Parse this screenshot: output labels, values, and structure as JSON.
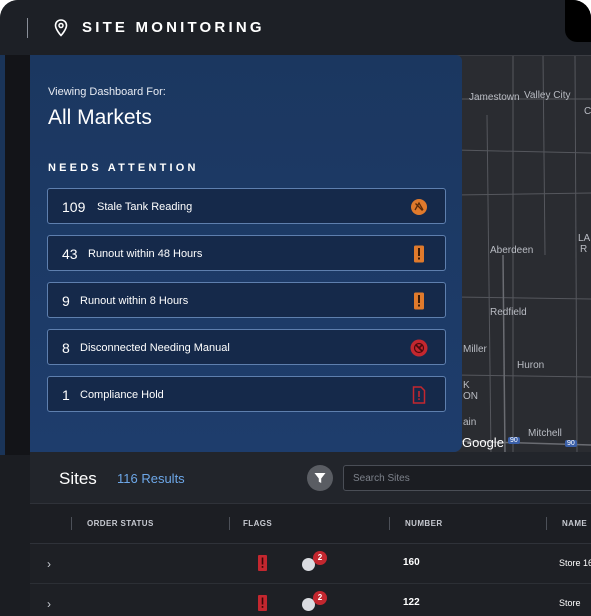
{
  "header": {
    "title": "SITE MONITORING"
  },
  "dashboard": {
    "viewing_label": "Viewing Dashboard For:",
    "market": "All Markets",
    "needs_attention_label": "NEEDS ATTENTION",
    "alerts": [
      {
        "count": "109",
        "label": "Stale Tank Reading",
        "icon": "stale-reading-icon",
        "color": "#e07a2c"
      },
      {
        "count": "43",
        "label": "Runout within 48 Hours",
        "icon": "warning-icon",
        "color": "#e07a2c"
      },
      {
        "count": "9",
        "label": "Runout within 8 Hours",
        "icon": "warning-icon",
        "color": "#e07a2c"
      },
      {
        "count": "8",
        "label": "Disconnected Needing Manual",
        "icon": "disconnected-icon",
        "color": "#c3272f"
      },
      {
        "count": "1",
        "label": "Compliance Hold",
        "icon": "compliance-doc-icon",
        "color": "#c3272f"
      }
    ]
  },
  "map": {
    "labels": [
      "Jamestown",
      "Valley City",
      "Ca",
      "Aberdeen",
      "LA",
      "R",
      "Redfield",
      "Miller",
      "Huron",
      "K",
      "ON",
      "ain",
      "Mitchell"
    ],
    "logo": "Google",
    "shields": [
      "90",
      "90"
    ]
  },
  "sites": {
    "title": "Sites",
    "results": "116 Results",
    "search_placeholder": "Search Sites",
    "columns": [
      "ORDER STATUS",
      "FLAGS",
      "NUMBER",
      "NAME"
    ],
    "rows": [
      {
        "flag_count": "2",
        "number": "160",
        "name": "Store 16"
      },
      {
        "flag_count": "2",
        "number": "122",
        "name": "Store"
      }
    ]
  },
  "colors": {
    "panel": "#1e3d6c",
    "accent": "#6da7e8",
    "alert_orange": "#e07a2c",
    "alert_red": "#c3272f"
  }
}
